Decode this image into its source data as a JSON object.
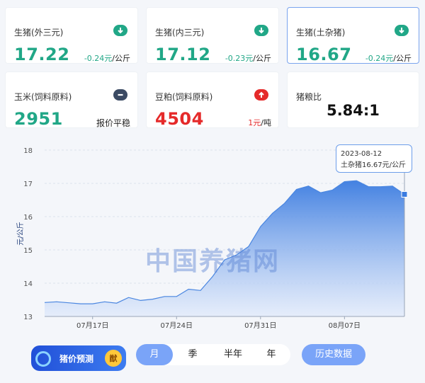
{
  "cards": [
    {
      "label": "生猪(外三元)",
      "price": "17.22",
      "change_value": "-0.24元",
      "change_unit": "/公斤",
      "trend": "down",
      "icon": "arrow-down-icon"
    },
    {
      "label": "生猪(内三元)",
      "price": "17.12",
      "change_value": "-0.23元",
      "change_unit": "/公斤",
      "trend": "down",
      "icon": "arrow-down-icon"
    },
    {
      "label": "生猪(土杂猪)",
      "price": "16.67",
      "change_value": "-0.24元",
      "change_unit": "/公斤",
      "trend": "down",
      "icon": "arrow-down-icon",
      "selected": true
    },
    {
      "label": "玉米(饲料原料)",
      "price": "2951",
      "change_text": "报价平稳",
      "trend": "flat",
      "icon": "minus-icon"
    },
    {
      "label": "豆粕(饲料原料)",
      "price": "4504",
      "change_value": "1元",
      "change_unit": "/吨",
      "trend": "up",
      "icon": "arrow-up-icon"
    },
    {
      "label": "猪粮比",
      "value": "5.84:1"
    }
  ],
  "colors": {
    "down": "#21a787",
    "up": "#e52a2a",
    "flat": "#3b4a63",
    "accent": "#7aa4f8",
    "line": "#4a86e0"
  },
  "chart_data": {
    "type": "area",
    "ylabel": "元/公斤",
    "ylim": [
      13,
      18
    ],
    "yticks": [
      "18",
      "17",
      "16",
      "15",
      "14",
      "13"
    ],
    "xticks": [
      "07月17日",
      "07月24日",
      "07月31日",
      "08月07日"
    ],
    "x": [
      "07-13",
      "07-14",
      "07-15",
      "07-16",
      "07-17",
      "07-18",
      "07-19",
      "07-20",
      "07-21",
      "07-22",
      "07-23",
      "07-24",
      "07-25",
      "07-26",
      "07-27",
      "07-28",
      "07-29",
      "07-30",
      "07-31",
      "08-01",
      "08-02",
      "08-03",
      "08-04",
      "08-05",
      "08-06",
      "08-07",
      "08-08",
      "08-09",
      "08-10",
      "08-11",
      "08-12"
    ],
    "values": [
      13.42,
      13.44,
      13.41,
      13.38,
      13.38,
      13.44,
      13.4,
      13.57,
      13.48,
      13.52,
      13.6,
      13.6,
      13.82,
      13.78,
      14.2,
      14.7,
      14.85,
      15.1,
      15.7,
      16.1,
      16.4,
      16.82,
      16.92,
      16.72,
      16.8,
      17.05,
      17.08,
      16.9,
      16.9,
      16.92,
      16.67
    ],
    "grid": true,
    "tooltip": {
      "date": "2023-08-12",
      "series": "土杂猪",
      "value": "16.67元/公斤"
    }
  },
  "watermark": "中国养猪网",
  "predict_button": {
    "label": "猪价预测",
    "badge": "猷"
  },
  "range_tabs": [
    {
      "label": "月",
      "active": true
    },
    {
      "label": "季",
      "active": false
    },
    {
      "label": "半年",
      "active": false
    },
    {
      "label": "年",
      "active": false
    }
  ],
  "history_button": "历史数据"
}
